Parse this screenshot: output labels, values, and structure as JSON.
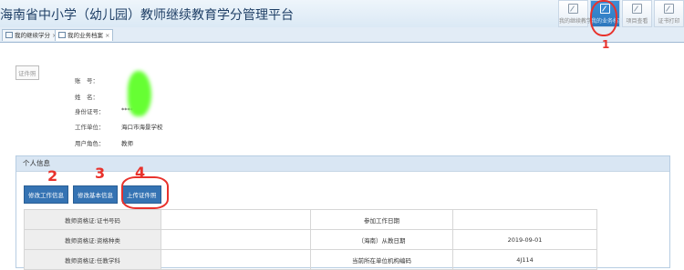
{
  "app": {
    "title": "海南省中小学（幼儿园）教师继续教育学分管理平台"
  },
  "toolbar": [
    {
      "label": "我的继续教学分",
      "icon": "edit-icon",
      "active": false
    },
    {
      "label": "我的业务档案",
      "icon": "edit-icon",
      "active": true
    },
    {
      "label": "项目查看",
      "icon": "edit-icon",
      "active": false
    },
    {
      "label": "证书打印",
      "icon": "edit-icon",
      "active": false
    }
  ],
  "tabs": [
    {
      "label": "我的继续学分",
      "close": "×"
    },
    {
      "label": "我的业务档案",
      "close": "×"
    }
  ],
  "profile": {
    "photo_alt": "证件照",
    "fields": [
      {
        "label": "账　号：",
        "value": ""
      },
      {
        "label": "姓　名：",
        "value": ""
      },
      {
        "label": "身份证号：",
        "value": "****"
      },
      {
        "label": "工作单位：",
        "value": "海口市海景学校"
      },
      {
        "label": "用户角色：",
        "value": "教师"
      }
    ]
  },
  "panel": {
    "title": "个人信息"
  },
  "buttons": {
    "edit_work": "修改工作信息",
    "edit_basic": "修改基本信息",
    "upload_photo": "上传证件照"
  },
  "table": {
    "rows": [
      {
        "l1": "教师资格证:证书号码",
        "v1": "",
        "l2": "参加工作日期",
        "v2": ""
      },
      {
        "l1": "教师资格证:资格种类",
        "v1": "",
        "l2": "（海南）从教日期",
        "v2": "2019-09-01"
      },
      {
        "l1": "教师资格证:任教学科",
        "v1": "",
        "l2": "当前所在单位机构编码",
        "v2": "4J114"
      }
    ]
  },
  "annotations": {
    "n1": "1",
    "n2": "2",
    "n3": "3",
    "n4": "4"
  },
  "colors": {
    "accent": "#3573b3",
    "annotation": "#e8322c",
    "redaction": "#66ff33"
  }
}
